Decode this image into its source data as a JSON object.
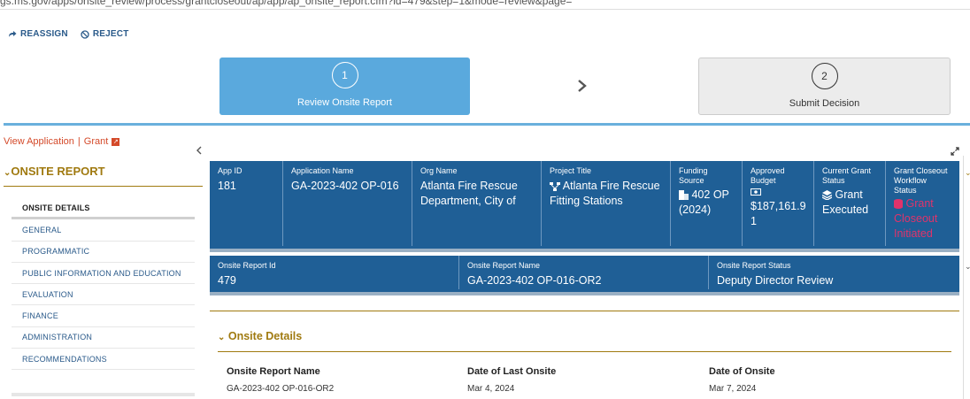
{
  "browser": {
    "url_fragment": "gs.ms.gov/apps/onsite_review/process/grantcloseout/ap/app/ap_onsite_report.cfm?id=479&step=1&mode=review&page="
  },
  "actions": {
    "reassign": "REASSIGN",
    "reject": "REJECT"
  },
  "steps": [
    {
      "number": "1",
      "label": "Review Onsite Report",
      "state": "active"
    },
    {
      "number": "2",
      "label": "Submit Decision",
      "state": "inactive"
    }
  ],
  "view_application": {
    "label": "View Application",
    "sep": "|",
    "grant": "Grant"
  },
  "sidebar": {
    "title": "ONSITE REPORT",
    "items": [
      {
        "label": "ONSITE DETAILS"
      },
      {
        "label": "GENERAL"
      },
      {
        "label": "PROGRAMMATIC"
      },
      {
        "label": "PUBLIC INFORMATION AND EDUCATION"
      },
      {
        "label": "EVALUATION"
      },
      {
        "label": "FINANCE"
      },
      {
        "label": "ADMINISTRATION"
      },
      {
        "label": "RECOMMENDATIONS"
      }
    ]
  },
  "summary": {
    "app_id": {
      "label": "App ID",
      "value": "181"
    },
    "application_name": {
      "label": "Application Name",
      "value": "GA-2023-402 OP-016"
    },
    "org_name": {
      "label": "Org Name",
      "value": "Atlanta Fire Rescue Department, City of"
    },
    "project_title": {
      "label": "Project Title",
      "value": "Atlanta Fire Rescue Fitting Stations"
    },
    "funding_source": {
      "label1": "Funding",
      "label2": "Source",
      "value1": "402 OP",
      "value2": "(2024)"
    },
    "approved_budget": {
      "label1": "Approved",
      "label2": "Budget",
      "value1": "$187,161.9",
      "value2": "1"
    },
    "current_grant_status": {
      "label1": "Current Grant",
      "label2": "Status",
      "value1": "Grant",
      "value2": "Executed"
    },
    "closeout_status": {
      "label1": "Grant Closeout",
      "label2": "Workflow",
      "label3": "Status",
      "value1": "Grant",
      "value2": "Closeout",
      "value3": "Initiated"
    }
  },
  "onsite_summary": {
    "report_id": {
      "label": "Onsite Report Id",
      "value": "479"
    },
    "report_name": {
      "label": "Onsite Report Name",
      "value": "GA-2023-402 OP-016-OR2"
    },
    "report_status": {
      "label": "Onsite Report Status",
      "value": "Deputy Director Review"
    }
  },
  "onsite_details": {
    "title": "Onsite Details",
    "fields": [
      {
        "label": "Onsite Report Name",
        "value": "GA-2023-402 OP-016-OR2"
      },
      {
        "label": "Date of Last Onsite",
        "value": "Mar 4, 2024"
      },
      {
        "label": "Date of Onsite",
        "value": "Mar 7, 2024"
      }
    ]
  },
  "colors": {
    "accent_blue": "#1f5f96",
    "step_active": "#5aa9dd",
    "gold": "#a07a10",
    "link_red": "#d44a2a",
    "status_pink": "#e0336b"
  }
}
